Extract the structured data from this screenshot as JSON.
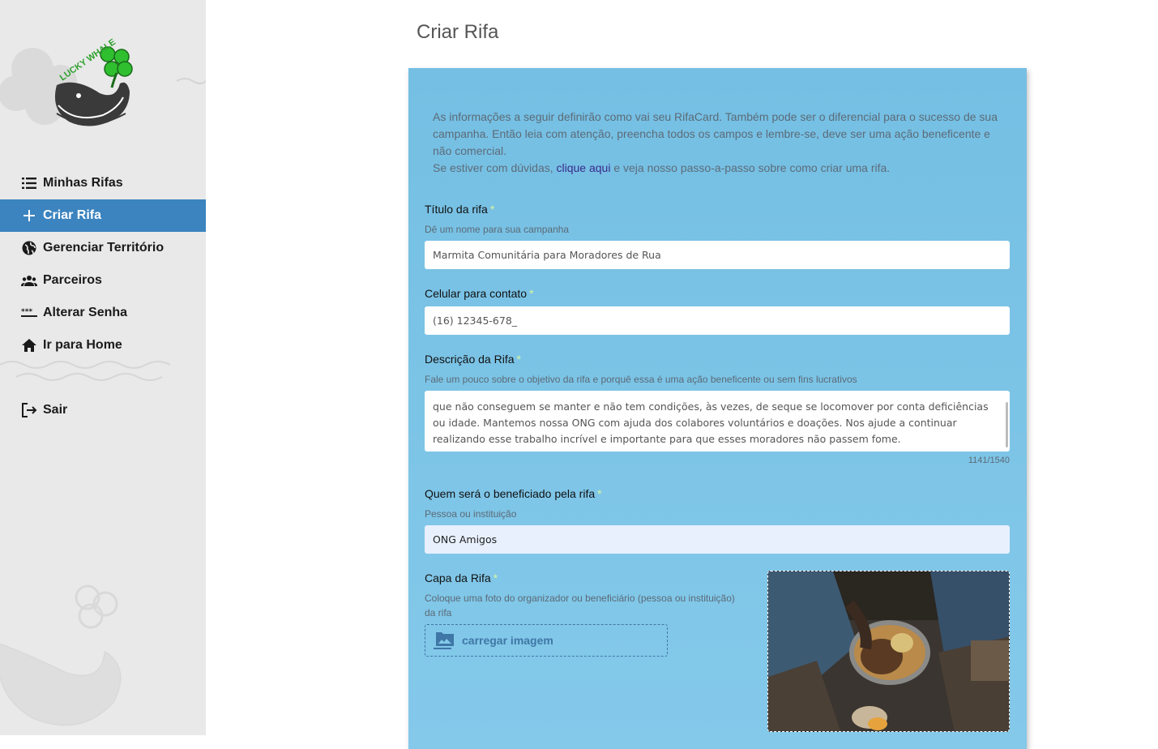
{
  "sidebar": {
    "logo_text": "LUCKY WHALE",
    "items": [
      {
        "label": "Minhas Rifas",
        "icon": "list-icon",
        "active": false
      },
      {
        "label": "Criar Rifa",
        "icon": "plus-icon",
        "active": true
      },
      {
        "label": "Gerenciar Território",
        "icon": "globe-icon",
        "active": false
      },
      {
        "label": "Parceiros",
        "icon": "people-icon",
        "active": false
      },
      {
        "label": "Alterar Senha",
        "icon": "password-icon",
        "active": false
      },
      {
        "label": "Ir para Home",
        "icon": "home-icon",
        "active": false
      }
    ],
    "logout": {
      "label": "Sair",
      "icon": "logout-icon"
    }
  },
  "page": {
    "title": "Criar Rifa"
  },
  "form": {
    "intro_line1": "As informações a seguir definirão como vai seu RifaCard. Também pode ser o diferencial para o sucesso de sua campanha. Então leia com atenção, preencha todos os campos e lembre-se, deve ser uma ação beneficente e não comercial.",
    "intro_prefix": "Se estiver com dúvidas, ",
    "intro_link": "clique aqui",
    "intro_suffix": " e veja nosso passo-a-passo sobre como criar uma rifa.",
    "required_mark": "*",
    "title_field": {
      "label": "Título da rifa",
      "hint": "Dê um nome para sua campanha",
      "value": "Marmita Comunitária para Moradores de Rua"
    },
    "phone_field": {
      "label": "Celular para contato",
      "value": "(16) 12345-678_"
    },
    "description_field": {
      "label": "Descrição da Rifa",
      "hint": "Fale um pouco sobre o objetivo da rifa e porquê essa é uma ação beneficente ou sem fins lucrativos",
      "visible_text": "que não conseguem se manter e não tem condições, às vezes, de seque se locomover por conta deficiências ou idade. Mantemos nossa ONG com ajuda dos colabores voluntários e doações. Nos ajude a continuar realizando esse trabalho incrível e importante para que esses moradores não passem fome.",
      "counter": "1141/1540"
    },
    "beneficiary_field": {
      "label": "Quem será o beneficiado pela rifa",
      "hint": "Pessoa ou instituição",
      "value": "ONG Amigos"
    },
    "cover_field": {
      "label": "Capa da Rifa",
      "hint": "Coloque uma foto do organizador ou beneficiário (pessoa ou instituição) da rifa",
      "upload_label": "carregar imagem",
      "upload_icon": "image-folder-icon"
    }
  },
  "colors": {
    "sidebar_bg": "#e9e9e9",
    "active_item": "#3b84bf",
    "card_bg": "#7cc4e6",
    "link": "#3a2a8a",
    "required": "#d6f5a0"
  }
}
